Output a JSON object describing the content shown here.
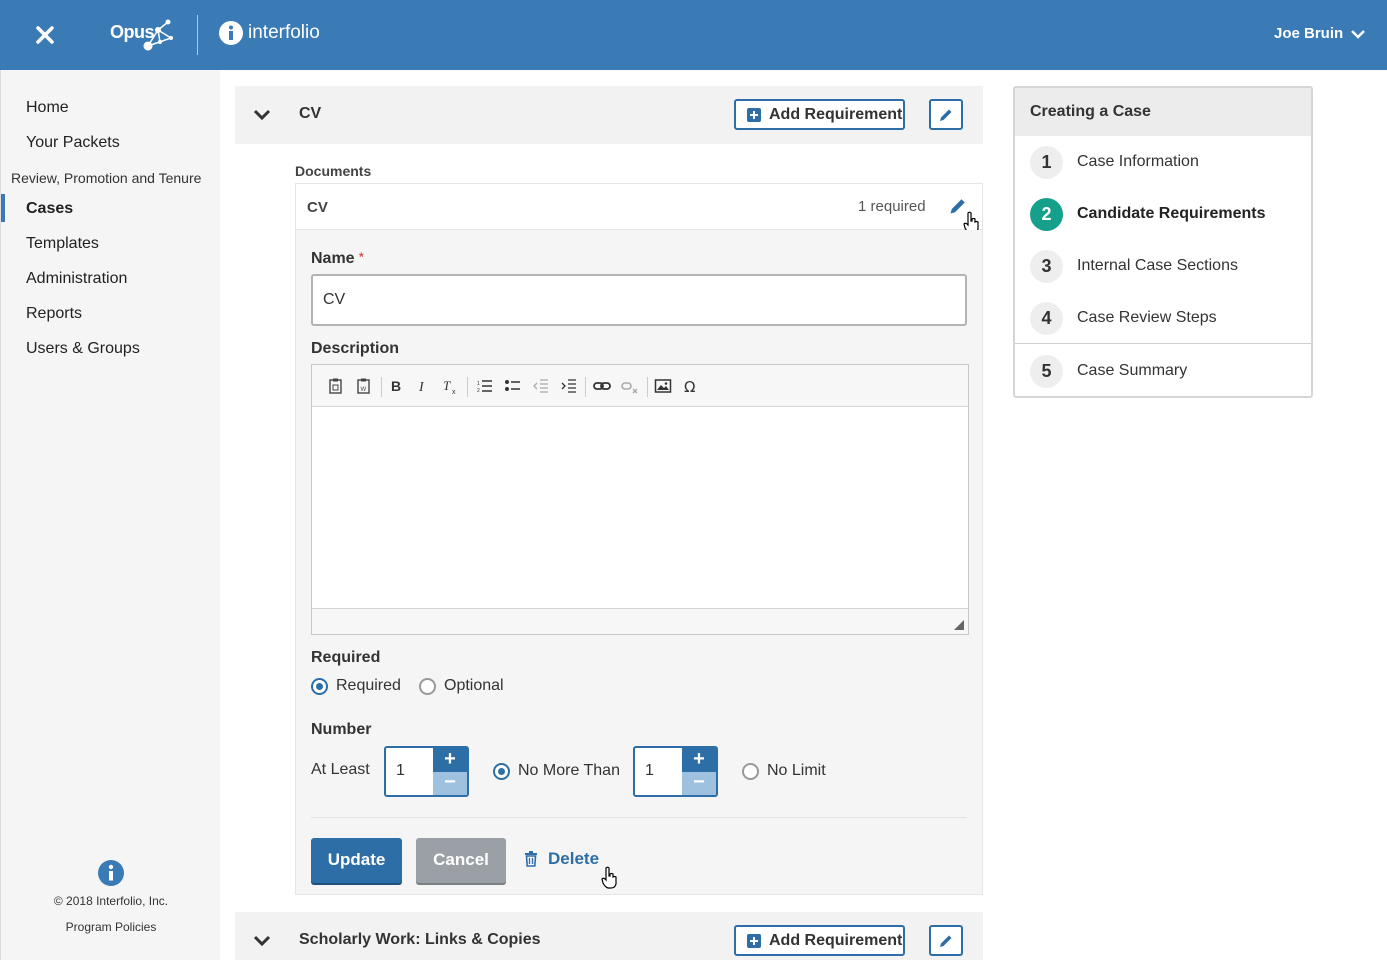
{
  "topbar": {
    "brand": "Opus",
    "partner": "interfolio",
    "user": "Joe Bruin"
  },
  "sidebar": {
    "items": [
      {
        "label": "Home"
      },
      {
        "label": "Your Packets"
      }
    ],
    "section": "Review, Promotion and Tenure",
    "section_items": [
      {
        "label": "Cases",
        "active": true
      },
      {
        "label": "Templates"
      },
      {
        "label": "Administration"
      },
      {
        "label": "Reports"
      },
      {
        "label": "Users & Groups"
      }
    ],
    "footer_copyright": "© 2018 Interfolio, Inc.",
    "footer_link": "Program Policies"
  },
  "sections": [
    {
      "title": "CV",
      "add_label": "Add Requirement"
    },
    {
      "title": "Scholarly Work: Links & Copies",
      "add_label": "Add Requirement"
    }
  ],
  "documents": {
    "label": "Documents",
    "row_name": "CV",
    "row_required": "1 required"
  },
  "form": {
    "name_label": "Name",
    "name_value": "CV",
    "description_label": "Description",
    "required_label": "Required",
    "required_options": [
      {
        "label": "Required",
        "selected": true
      },
      {
        "label": "Optional",
        "selected": false
      }
    ],
    "number_label": "Number",
    "at_least_label": "At Least",
    "at_least_value": "1",
    "no_more_than_label": "No More Than",
    "no_more_than_selected": true,
    "no_more_than_value": "1",
    "no_limit_label": "No Limit",
    "no_limit_selected": false,
    "stepper_plus": "+",
    "stepper_minus": "−",
    "update_label": "Update",
    "cancel_label": "Cancel",
    "delete_label": "Delete"
  },
  "editor_toolbar": [
    "paste-icon",
    "paste-word-icon",
    "bold-icon",
    "italic-icon",
    "remove-format-icon",
    "numbered-list-icon",
    "bulleted-list-icon",
    "outdent-icon",
    "indent-icon",
    "link-icon",
    "unlink-icon",
    "image-icon",
    "special-char-icon"
  ],
  "steps": {
    "title": "Creating a Case",
    "items": [
      {
        "num": "1",
        "label": "Case Information",
        "active": false
      },
      {
        "num": "2",
        "label": "Candidate Requirements",
        "active": true
      },
      {
        "num": "3",
        "label": "Internal Case Sections",
        "active": false
      },
      {
        "num": "4",
        "label": "Case Review Steps",
        "active": false
      },
      {
        "num": "5",
        "label": "Case Summary",
        "active": false
      }
    ]
  },
  "colors": {
    "primary": "#3a7ab5",
    "accent_step": "#15a08c",
    "required_star": "#d9534f"
  }
}
